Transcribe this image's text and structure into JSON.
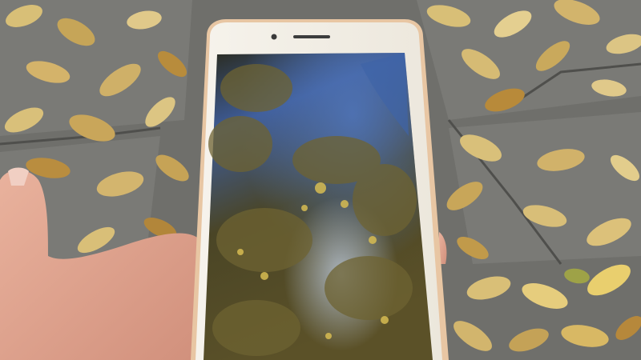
{
  "scene": {
    "subject": "phone",
    "colors": {
      "pavement": "#6e6e6a",
      "leaf_light": "#d9c27a",
      "leaf_dark": "#b58b3a",
      "phone_body": "#f4f1ea",
      "phone_edge": "#e7c39c",
      "screen_sky": "#3d5f9c",
      "screen_foliage": "#4c4426",
      "skin": "#e5a895"
    },
    "icons": [
      "front-camera-icon",
      "earpiece-icon"
    ]
  }
}
